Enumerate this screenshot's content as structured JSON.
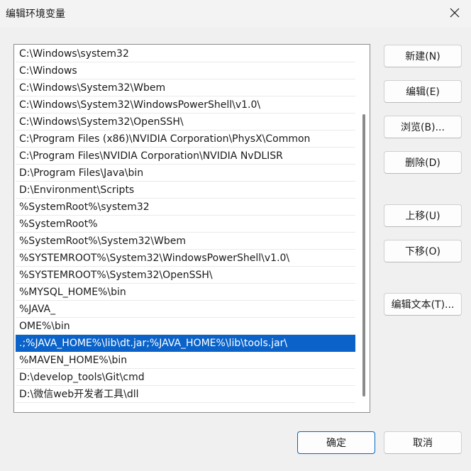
{
  "window": {
    "title": "编辑环境变量"
  },
  "paths": [
    "C:\\Windows\\system32",
    "C:\\Windows",
    "C:\\Windows\\System32\\Wbem",
    "C:\\Windows\\System32\\WindowsPowerShell\\v1.0\\",
    "C:\\Windows\\System32\\OpenSSH\\",
    "C:\\Program Files (x86)\\NVIDIA Corporation\\PhysX\\Common",
    "C:\\Program Files\\NVIDIA Corporation\\NVIDIA NvDLISR",
    "D:\\Program Files\\Java\\bin",
    "D:\\Environment\\Scripts",
    "%SystemRoot%\\system32",
    "%SystemRoot%",
    "%SystemRoot%\\System32\\Wbem",
    "%SYSTEMROOT%\\System32\\WindowsPowerShell\\v1.0\\",
    "%SYSTEMROOT%\\System32\\OpenSSH\\",
    "%MYSQL_HOME%\\bin",
    "%JAVA_",
    "OME%\\bin",
    ".;%JAVA_HOME%\\lib\\dt.jar;%JAVA_HOME%\\lib\\tools.jar\\",
    "%MAVEN_HOME%\\bin",
    "D:\\develop_tools\\Git\\cmd",
    "D:\\微信web开发者工具\\dll"
  ],
  "selected_index": 17,
  "side_buttons": {
    "new": "新建(N)",
    "edit": "编辑(E)",
    "browse": "浏览(B)...",
    "delete": "删除(D)",
    "move_up": "上移(U)",
    "move_down": "下移(O)",
    "edit_text": "编辑文本(T)..."
  },
  "footer": {
    "ok": "确定",
    "cancel": "取消"
  },
  "icons": {
    "close": "close-icon"
  },
  "colors": {
    "selection": "#0b63c9",
    "primary_border": "#0067c0"
  }
}
